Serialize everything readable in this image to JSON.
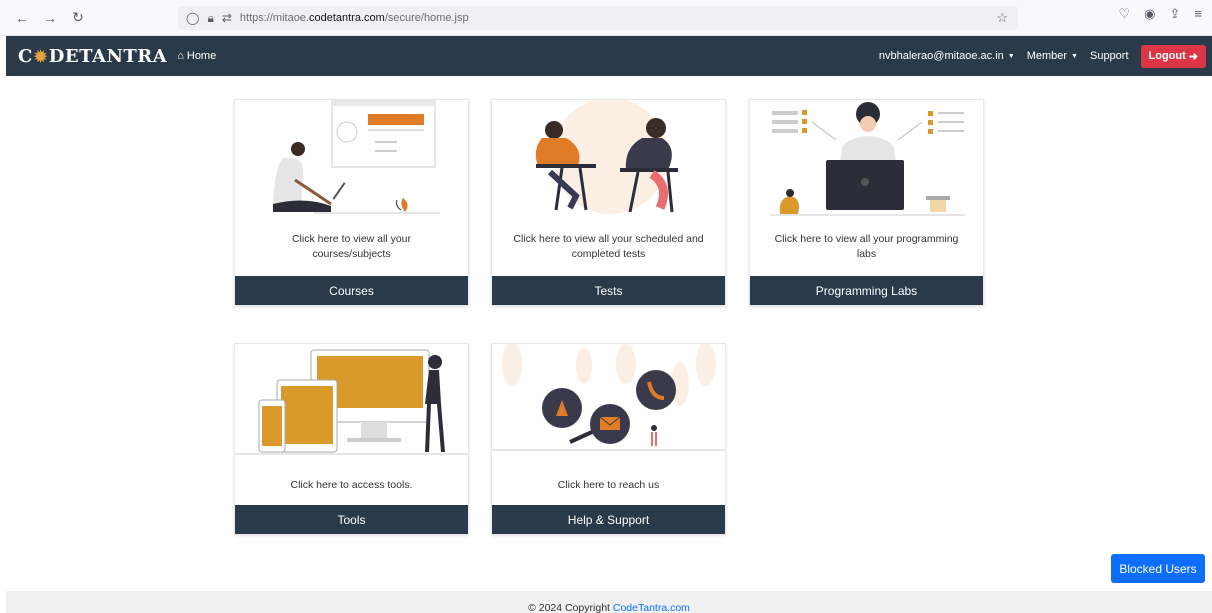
{
  "browser": {
    "url_prefix": "https://mitaoe.",
    "url_host": "codetantra.com",
    "url_path": "/secure/home.jsp"
  },
  "navbar": {
    "brand_c": "C",
    "brand_rest": "DETANTRA",
    "home_label": "Home",
    "user_email": "nvbhalerao@mitaoe.ac.in",
    "member_label": "Member",
    "support_label": "Support",
    "logout_label": "Logout"
  },
  "cards": [
    {
      "text": "Click here to view all your courses/subjects",
      "button": "Courses"
    },
    {
      "text": "Click here to view all your scheduled and completed tests",
      "button": "Tests"
    },
    {
      "text": "Click here to view all your programming labs",
      "button": "Programming Labs"
    },
    {
      "text": "Click here to access tools.",
      "button": "Tools"
    },
    {
      "text": "Click here to reach us",
      "button": "Help & Support"
    }
  ],
  "blocked_users_label": "Blocked Users",
  "footer": {
    "copyright": "© 2024 Copyright",
    "link": "CodeTantra.com"
  },
  "colors": {
    "navbar": "#2b3a4a",
    "accent_orange": "#e07b27",
    "accent_gold": "#d99a2b",
    "logout": "#dc3545",
    "primary": "#0d6efd"
  }
}
